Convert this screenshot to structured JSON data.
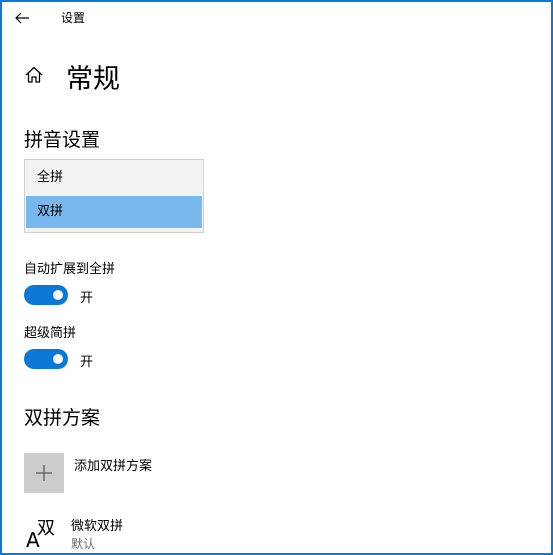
{
  "window": {
    "title": "设置",
    "border_color": "#0a7ad7"
  },
  "page": {
    "title": "常规"
  },
  "pinyin_settings": {
    "heading": "拼音设置",
    "options": [
      {
        "label": "全拼",
        "selected": false
      },
      {
        "label": "双拼",
        "selected": true
      }
    ]
  },
  "auto_expand": {
    "label": "自动扩展到全拼",
    "state_text": "开",
    "on": true
  },
  "super_jianpin": {
    "label": "超级简拼",
    "state_text": "开",
    "on": true
  },
  "shuangpin_scheme": {
    "heading": "双拼方案",
    "add_label": "添加双拼方案",
    "items": [
      {
        "icon_text": "双",
        "icon_letter": "A",
        "name": "微软双拼",
        "subtitle": "默认"
      }
    ]
  },
  "colors": {
    "accent": "#0a78d7",
    "selected_item": "#78b8ec",
    "add_tile": "#cccccc"
  }
}
